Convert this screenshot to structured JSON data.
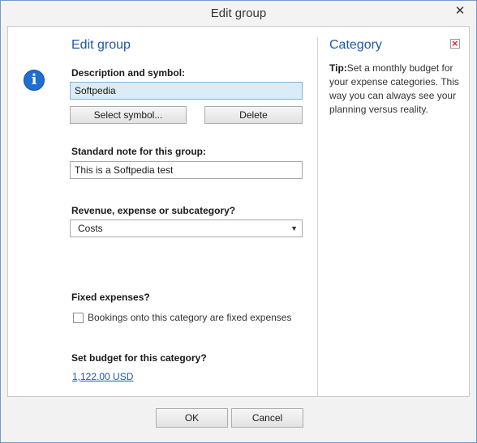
{
  "window": {
    "title": "Edit group",
    "close_icon": "close-icon"
  },
  "form": {
    "heading": "Edit group",
    "description_label": "Description and symbol:",
    "description_value": "Softpedia",
    "select_symbol_label": "Select symbol...",
    "delete_label": "Delete",
    "note_label": "Standard note for this group:",
    "note_value": "This is a Softpedia test",
    "type_label": "Revenue, expense or subcategory?",
    "type_selected": "Costs",
    "fixed_label": "Fixed expenses?",
    "fixed_checkbox_label": "Bookings onto this category are fixed expenses",
    "fixed_checked": false,
    "budget_label": "Set budget for this category?",
    "budget_value": "1,122.00 USD"
  },
  "sidebar": {
    "title": "Category",
    "tip_prefix": "Tip:",
    "tip_text": "Set a monthly budget for your expense categories. This way you can always see your planning versus reality."
  },
  "footer": {
    "ok_label": "OK",
    "cancel_label": "Cancel"
  },
  "colors": {
    "accent": "#1f5aa8",
    "info_icon": "#1f6fd1",
    "active_input": "#d9ecf8",
    "link": "#1a56b8"
  }
}
